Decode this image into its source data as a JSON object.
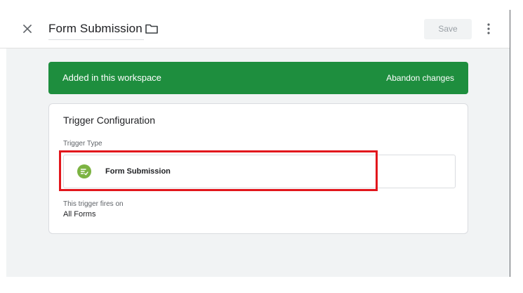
{
  "header": {
    "title": "Form Submission",
    "save_label": "Save"
  },
  "banner": {
    "text": "Added in this workspace",
    "action_label": "Abandon changes"
  },
  "card": {
    "title": "Trigger Configuration",
    "trigger_type_label": "Trigger Type",
    "trigger_type_value": "Form Submission",
    "fires_on_label": "This trigger fires on",
    "fires_on_value": "All Forms"
  },
  "colors": {
    "banner_green": "#1e8e3e",
    "icon_green": "#7cb342",
    "highlight_red": "#e2161c"
  },
  "icons": {
    "close": "close-icon",
    "folder": "folder-icon",
    "more": "more-vert-icon",
    "trigger": "form-submission-icon"
  }
}
